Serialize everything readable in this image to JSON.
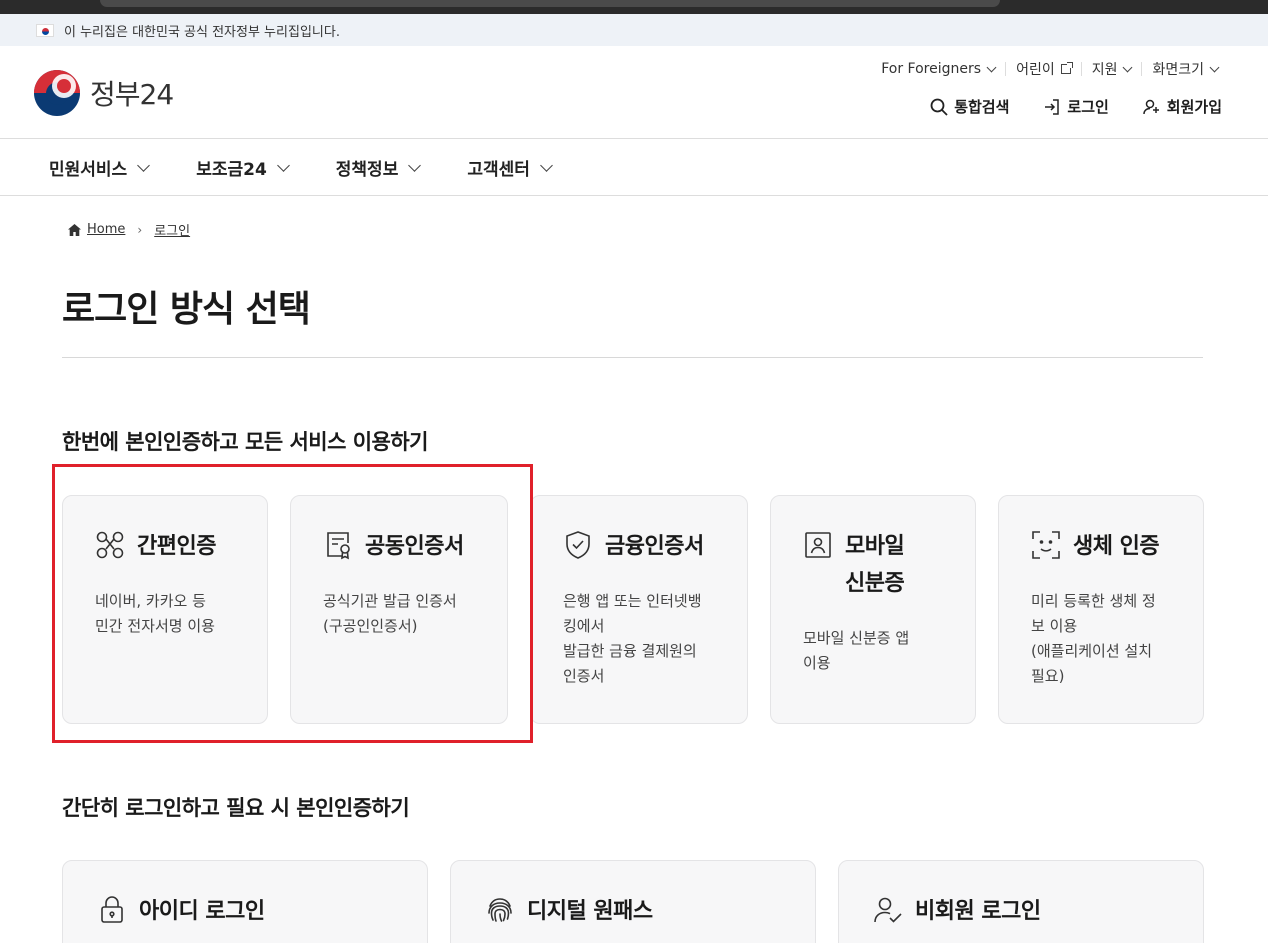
{
  "banner": {
    "text": "이 누리집은 대한민국 공식 전자정부 누리집입니다."
  },
  "logo": {
    "text": "정부24"
  },
  "util_nav": [
    {
      "label": "For Foreigners",
      "icon": "chevron-down-icon"
    },
    {
      "label": "어린이",
      "icon": "external-link-icon"
    },
    {
      "label": "지원",
      "icon": "chevron-down-icon"
    },
    {
      "label": "화면크기",
      "icon": "chevron-down-icon"
    }
  ],
  "main_actions": [
    {
      "label": "통합검색",
      "icon": "search-icon"
    },
    {
      "label": "로그인",
      "icon": "login-icon"
    },
    {
      "label": "회원가입",
      "icon": "user-plus-icon"
    }
  ],
  "gnb": [
    {
      "label": "민원서비스"
    },
    {
      "label": "보조금24"
    },
    {
      "label": "정책정보"
    },
    {
      "label": "고객센터"
    }
  ],
  "breadcrumb": {
    "home": "Home",
    "current": "로그인"
  },
  "page_title": "로그인 방식 선택",
  "section1": {
    "title": "한번에 본인인증하고 모든 서비스 이용하기",
    "cards": [
      {
        "name": "간편인증",
        "desc": "네이버, 카카오 등\n민간 전자서명 이용",
        "icon": "nodes-icon"
      },
      {
        "name": "공동인증서",
        "desc": "공식기관 발급 인증서\n(구공인인증서)",
        "icon": "certificate-icon"
      },
      {
        "name": "금융인증서",
        "desc": "은행 앱 또는 인터넷뱅\n킹에서\n발급한 금융 결제원의\n인증서",
        "icon": "shield-check-icon"
      },
      {
        "name": "모바일\n신분증",
        "desc": "모바일 신분증 앱\n이용",
        "icon": "id-card-icon"
      },
      {
        "name": "생체 인증",
        "desc": "미리 등록한 생체 정\n보 이용\n(애플리케이션 설치\n필요)",
        "icon": "face-scan-icon"
      }
    ]
  },
  "section2": {
    "title": "간단히 로그인하고 필요 시 본인인증하기",
    "cards": [
      {
        "name": "아이디 로그인",
        "icon": "lock-icon"
      },
      {
        "name": "디지털 원패스",
        "icon": "fingerprint-icon"
      },
      {
        "name": "비회원 로그인",
        "icon": "user-check-icon"
      }
    ]
  },
  "colors": {
    "highlight": "#e0202a",
    "card_bg": "#f7f7f8"
  }
}
